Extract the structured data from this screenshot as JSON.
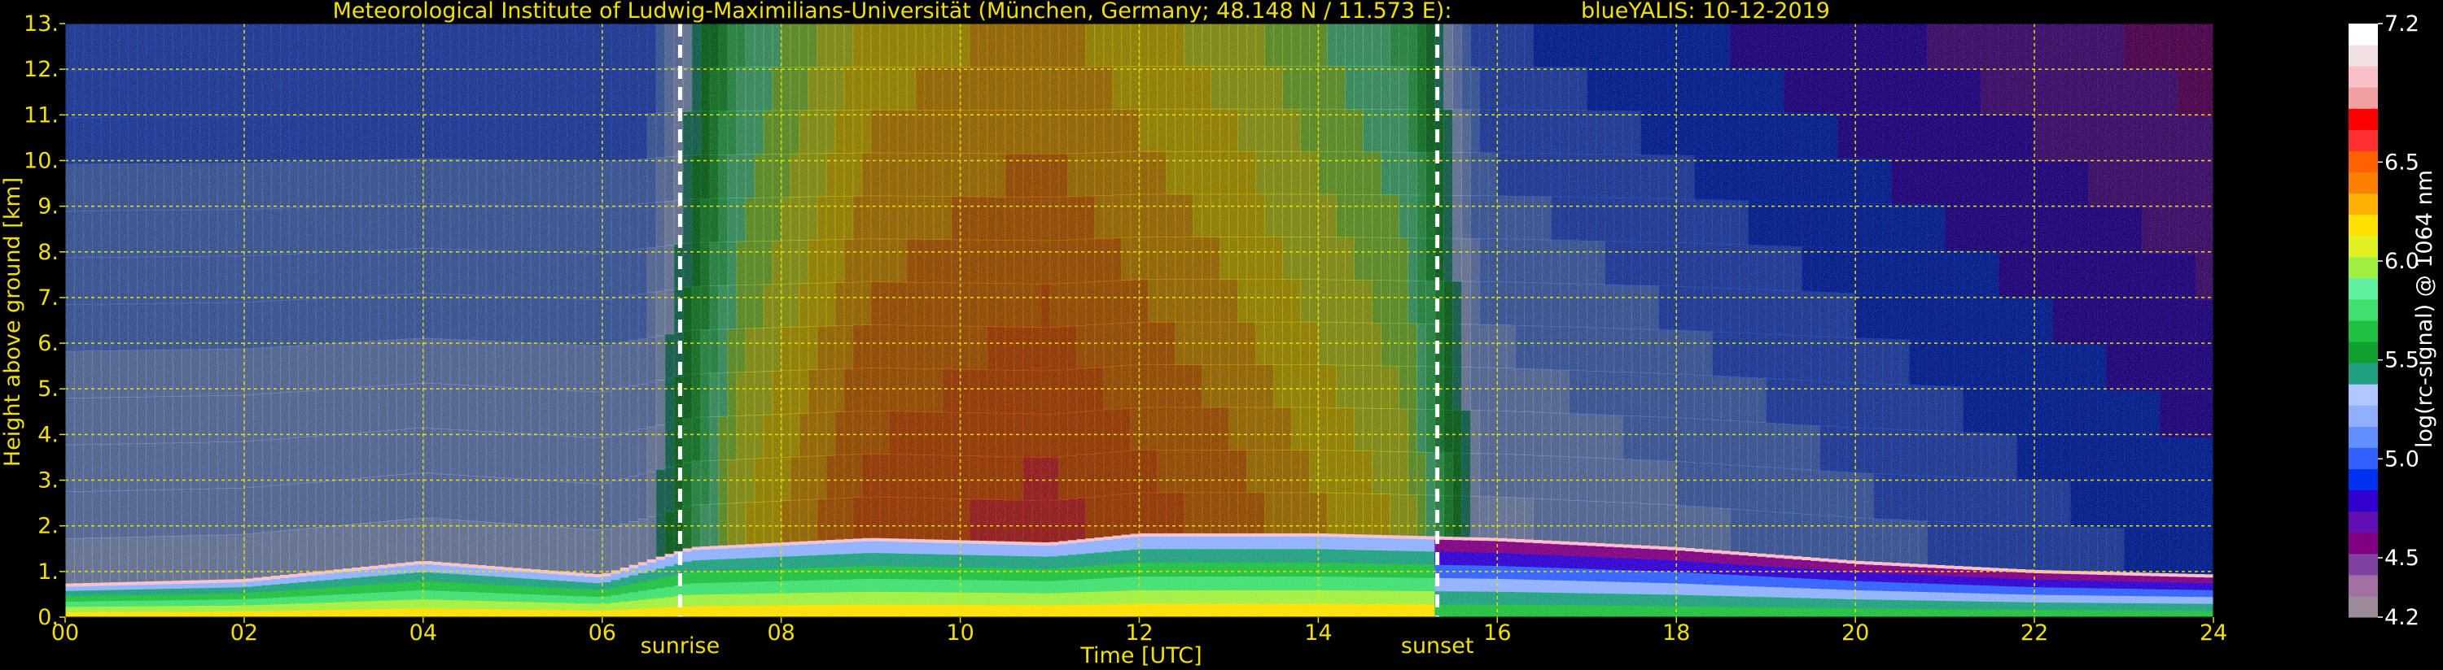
{
  "chart_data": {
    "type": "heatmap",
    "title": "Meteorological Institute of Ludwig-Maximilians-Universität (München, Germany; 48.148 N / 11.573 E):",
    "subtitle": "blueYALIS: 10-12-2019",
    "xlabel": "Time [UTC]",
    "ylabel": "Height above ground [km]",
    "xlim": [
      0,
      24
    ],
    "ylim": [
      0,
      13
    ],
    "x_ticks": [
      "00",
      "02",
      "04",
      "06",
      "08",
      "10",
      "12",
      "14",
      "16",
      "18",
      "20",
      "22",
      "24"
    ],
    "y_ticks": [
      "0.",
      "1.",
      "2.",
      "3.",
      "4.",
      "5.",
      "6.",
      "7.",
      "8.",
      "9.",
      "10.",
      "11.",
      "12.",
      "13."
    ],
    "grid": true,
    "events": [
      {
        "label": "sunrise",
        "time": 6.87
      },
      {
        "label": "sunset",
        "time": 15.33
      }
    ],
    "colorbar": {
      "label": "log(rc-signal) @ 1064 nm",
      "min": 4.2,
      "max": 7.2,
      "ticks": [
        "7.2",
        "6.5",
        "6.0",
        "5.5",
        "5.0",
        "4.5",
        "4.2"
      ],
      "tick_values": [
        7.2,
        6.5,
        6.0,
        5.5,
        5.0,
        4.5,
        4.2
      ],
      "colors": [
        "#9a8a9a",
        "#a070a0",
        "#8040a0",
        "#800080",
        "#6010b0",
        "#3000d0",
        "#0030f0",
        "#3060ff",
        "#6090ff",
        "#90b0ff",
        "#b0c8ff",
        "#20a080",
        "#10a030",
        "#20c040",
        "#40e070",
        "#60f0a0",
        "#a0f040",
        "#e0f020",
        "#ffe000",
        "#ffb000",
        "#ff8000",
        "#ff6000",
        "#ff3030",
        "#ff0000",
        "#f0a0a0",
        "#f8c0c8",
        "#f0e0e0",
        "#ffffff"
      ]
    },
    "layers": [
      {
        "name": "upper",
        "y": [
          2.0,
          13.0
        ],
        "dominant_signal_by_hour": [
          [
            0,
            5.3
          ],
          [
            6.5,
            5.3
          ],
          [
            7.5,
            6.1
          ],
          [
            9,
            6.5
          ],
          [
            11,
            6.6
          ],
          [
            13,
            6.4
          ],
          [
            15,
            6.1
          ],
          [
            15.8,
            5.3
          ],
          [
            24,
            4.9
          ]
        ]
      },
      {
        "name": "boundary_layer_top_km",
        "points": [
          [
            0,
            0.7
          ],
          [
            2,
            0.8
          ],
          [
            4,
            1.2
          ],
          [
            6,
            0.9
          ],
          [
            7,
            1.5
          ],
          [
            9,
            1.7
          ],
          [
            11,
            1.6
          ],
          [
            12,
            1.8
          ],
          [
            14,
            1.8
          ],
          [
            16,
            1.7
          ],
          [
            18,
            1.5
          ],
          [
            20,
            1.2
          ],
          [
            22,
            1.0
          ],
          [
            24,
            0.9
          ]
        ]
      }
    ]
  }
}
